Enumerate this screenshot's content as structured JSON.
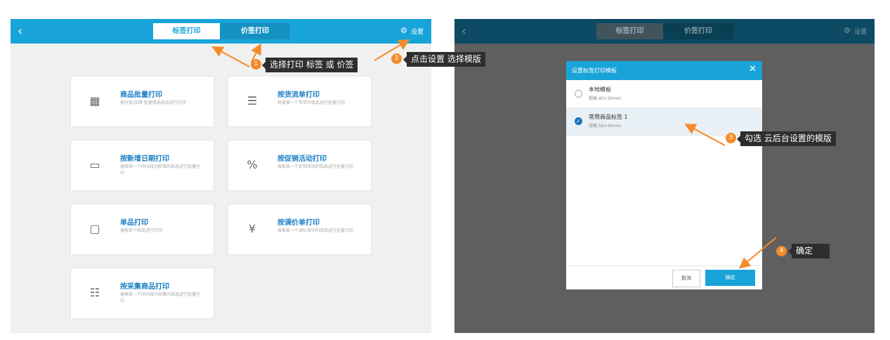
{
  "left_screen": {
    "back_icon": "chevron-left-icon",
    "tabs": [
      {
        "label": "标签打印",
        "active": true
      },
      {
        "label": "价签打印",
        "active": false
      }
    ],
    "settings_label": "设置",
    "cards": [
      {
        "title": "商品批量打印",
        "desc": "按分类/品牌 批量筛选商品进行打印",
        "icon": "boxes-icon"
      },
      {
        "title": "按货流单打印",
        "desc": "按搜索一个货单中商品进行批量打印",
        "icon": "clipboard-icon"
      },
      {
        "title": "按新增日期打印",
        "desc": "搜索某一个时间段内新增的商品进行批量打印",
        "icon": "calendar-icon"
      },
      {
        "title": "按促销活动打印",
        "desc": "搜索某一个促销活动的商品进行批量打印",
        "icon": "promo-percent-icon"
      },
      {
        "title": "单品打印",
        "desc": "搜索单个商品进行打印",
        "icon": "single-item-icon"
      },
      {
        "title": "按调价单打印",
        "desc": "搜索某一个调价单中的商品进行批量打印",
        "icon": "price-clipboard-icon"
      },
      {
        "title": "按采集商品打印",
        "desc": "搜索某一个时间段内采集的商品进行批量打印",
        "icon": "clipboard-list-icon"
      }
    ]
  },
  "right_screen": {
    "tabs": [
      {
        "label": "标签打印"
      },
      {
        "label": "价签打印"
      }
    ],
    "settings_label": "设置",
    "dialog": {
      "title": "设置标签打印模板",
      "options": [
        {
          "name": "本地模板",
          "spec": "规格:40×30mm",
          "selected": false
        },
        {
          "name": "常用商品标签 1",
          "spec": "规格:56×40mm",
          "selected": true
        }
      ],
      "cancel_label": "取消",
      "confirm_label": "确定"
    }
  },
  "callouts": [
    {
      "num": "1",
      "text": "选择打印 标签 或 价签"
    },
    {
      "num": "2",
      "text": "点击设置 选择模版"
    },
    {
      "num": "3",
      "text": "勾选 云后台设置的模版"
    },
    {
      "num": "4",
      "text": "确定"
    }
  ],
  "colors": {
    "brand_blue": "#19a4d9",
    "dark_bar": "#0d4a63",
    "callout_orange": "#f48b2a",
    "tooltip_bg": "#2e2e2e"
  }
}
